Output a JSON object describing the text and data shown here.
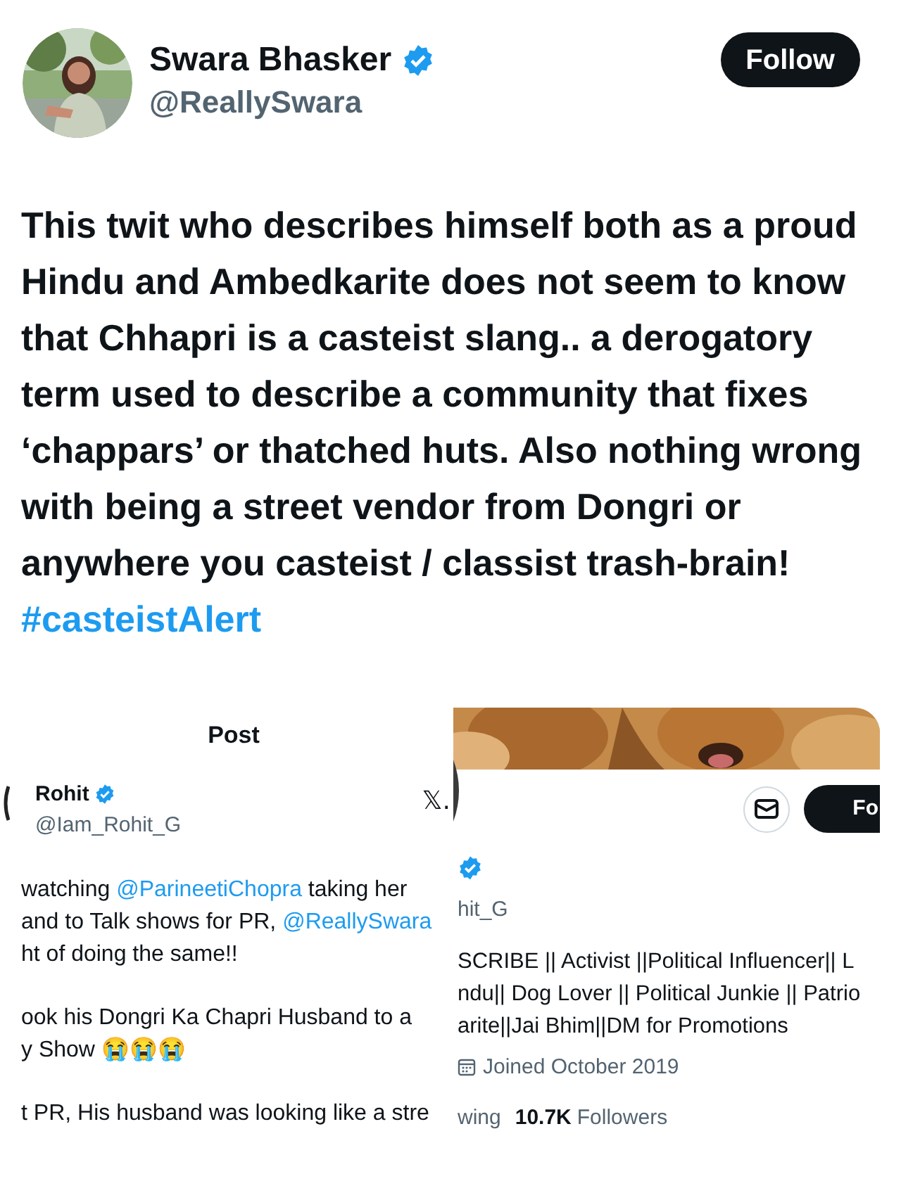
{
  "author": {
    "name": "Swara Bhasker",
    "verified": true,
    "handle": "@ReallySwara"
  },
  "follow_button": "Follow",
  "tweet": {
    "text": "This twit who describes himself both as a proud Hindu and Ambedkarite does not seem to know that Chhapri is a casteist slang.. a derogatory term used to describe a community that fixes ‘chappars’ or thatched huts. Also nothing wrong with being a street vendor from Dongri or anywhere you casteist / classist trash-brain!",
    "hashtag": "#casteistAlert"
  },
  "left_screenshot": {
    "title": "Post",
    "name": "Rohit",
    "verified": true,
    "handle": "@Iam_Rohit_G",
    "logo": "𝕏.",
    "lines": [
      [
        {
          "kind": "text",
          "text": "watching "
        },
        {
          "kind": "mention",
          "text": "@ParineetiChopra"
        },
        {
          "kind": "text",
          "text": " taking her"
        }
      ],
      [
        {
          "kind": "text",
          "text": "and to Talk shows for PR, "
        },
        {
          "kind": "mention",
          "text": "@ReallySwara"
        }
      ],
      [
        {
          "kind": "text",
          "text": "ht of doing the same!!"
        }
      ],
      [
        {
          "kind": "gap"
        }
      ],
      [
        {
          "kind": "text",
          "text": "ook his Dongri Ka Chapri Husband to a"
        }
      ],
      [
        {
          "kind": "text",
          "text": "y Show 😭😭😭"
        }
      ],
      [
        {
          "kind": "gap"
        }
      ],
      [
        {
          "kind": "text",
          "text": "t PR, His husband was looking like a stre"
        }
      ]
    ]
  },
  "right_screenshot": {
    "follow_button": "Fo",
    "verified": true,
    "handle": "hit_G",
    "bio": [
      "SCRIBE || Activist ||Political Influencer|| L",
      "ndu|| Dog Lover || Political Junkie || Patrio",
      "arite||Jai Bhim||DM for Promotions"
    ],
    "joined": "Joined October 2019",
    "following_label": "wing",
    "followers_count": "10.7K",
    "followers_label": "Followers"
  }
}
